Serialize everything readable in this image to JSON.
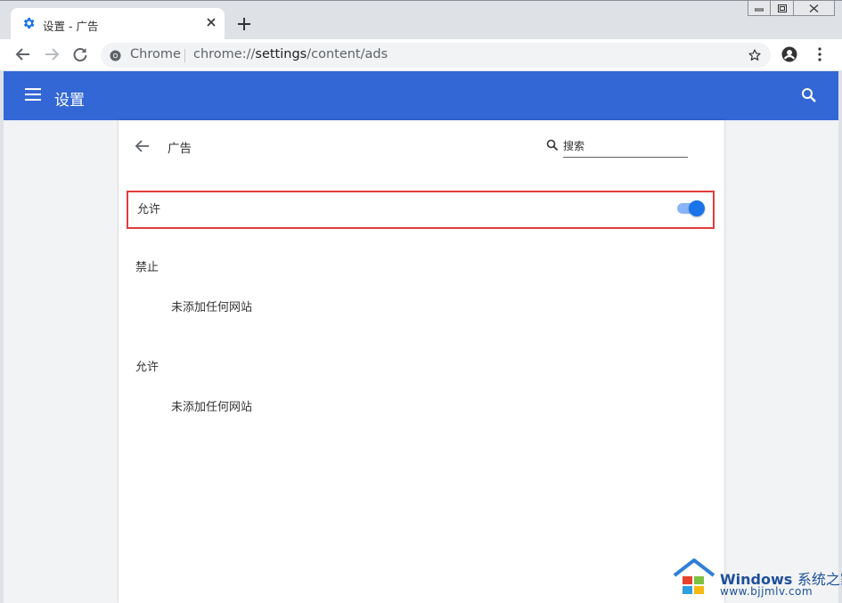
{
  "tab": {
    "title": "设置 - 广告"
  },
  "omnibox": {
    "site_name": "Chrome",
    "url_scheme": "chrome://",
    "url_host": "settings",
    "url_path": "/content/ads"
  },
  "header": {
    "title": "设置"
  },
  "page": {
    "title": "广告",
    "search_placeholder": "搜索",
    "allow_toggle": {
      "label": "允许",
      "on": true
    },
    "blocked_section": {
      "title": "禁止",
      "empty_text": "未添加任何网站"
    },
    "allowed_section": {
      "title": "允许",
      "empty_text": "未添加任何网站"
    }
  },
  "watermark": {
    "brand": "Windows",
    "brand_cn": "系统之家",
    "url": "www.bjjmlv.com"
  },
  "colors": {
    "header_blue": "#3367d6",
    "toggle_blue": "#1a73e8",
    "highlight_red": "#e23c3c"
  }
}
